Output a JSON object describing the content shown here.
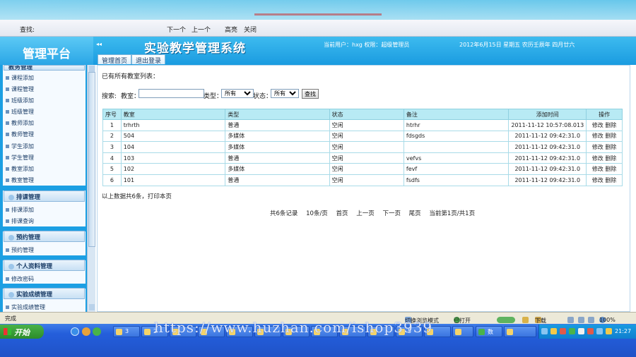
{
  "findbar": {
    "find_label": "查找:",
    "next": "下一个",
    "prev": "上一个",
    "highlight": "高亮",
    "close": "关闭"
  },
  "header": {
    "logo": "管理平台",
    "system_title": "实验教学管理系统",
    "user_info": "当前用户：hxg 权限：超级管理员",
    "date_info": "2012年6月15日 星期五 农历壬辰年 四月廿六",
    "collapse": "◂◂"
  },
  "tabs": [
    "管理首页",
    "退出登录"
  ],
  "sidebar": {
    "top_partial": "教务管理",
    "group1_items": [
      "课程添加",
      "课程管理",
      "班级添加",
      "班级管理",
      "教师添加",
      "教师管理",
      "学生添加",
      "学生管理",
      "教室添加",
      "教室管理"
    ],
    "groups": [
      {
        "title": "排课管理",
        "items": [
          "排课添加",
          "排课查询"
        ]
      },
      {
        "title": "预约管理",
        "items": [
          "预约管理"
        ]
      },
      {
        "title": "个人资料管理",
        "items": [
          "修改密码"
        ]
      },
      {
        "title": "实验成绩管理",
        "items": [
          "实验成绩管理"
        ]
      }
    ]
  },
  "main": {
    "title": "已有所有教室列表：",
    "search": {
      "label": "搜索:",
      "room_label": "教室：",
      "room_value": "",
      "type_label": "类型：",
      "type_selected": "所有",
      "status_label": "状态：",
      "status_selected": "所有",
      "button": "查找"
    },
    "table": {
      "headers": [
        "序号",
        "教室",
        "类型",
        "状态",
        "备注",
        "添加时间",
        "操作"
      ],
      "rows": [
        {
          "no": "1",
          "room": "trhrth",
          "type": "普通",
          "status": "空闲",
          "note": "htrhr",
          "time": "2011-11-12 10:57:08.013",
          "edit": "修改",
          "del": "删除"
        },
        {
          "no": "2",
          "room": "504",
          "type": "多媒体",
          "status": "空闲",
          "note": "fdsgds",
          "time": "2011-11-12 09:42:31.0",
          "edit": "修改",
          "del": "删除"
        },
        {
          "no": "3",
          "room": "104",
          "type": "多媒体",
          "status": "空闲",
          "note": "",
          "time": "2011-11-12 09:42:31.0",
          "edit": "修改",
          "del": "删除"
        },
        {
          "no": "4",
          "room": "103",
          "type": "普通",
          "status": "空闲",
          "note": "vefvs",
          "time": "2011-11-12 09:42:31.0",
          "edit": "修改",
          "del": "删除"
        },
        {
          "no": "5",
          "room": "102",
          "type": "多媒体",
          "status": "空闲",
          "note": "fevf",
          "time": "2011-11-12 09:42:31.0",
          "edit": "修改",
          "del": "删除"
        },
        {
          "no": "6",
          "room": "101",
          "type": "普通",
          "status": "空闲",
          "note": "fsdfs",
          "time": "2011-11-12 09:42:31.0",
          "edit": "修改",
          "del": "删除"
        }
      ]
    },
    "summary": "以上数据共6条，打印本页",
    "pager": {
      "total": "共6条记录",
      "per_page": "10条/页",
      "first": "首页",
      "prev": "上一页",
      "next": "下一页",
      "last": "尾页",
      "current": "当前第1页/共1页"
    }
  },
  "statusbar": {
    "done": "完成",
    "compat_mode": "切换浏览模式",
    "opened": "已打开",
    "download": "下载",
    "zoom": "100%"
  },
  "taskbar": {
    "start": "开始",
    "tasks": [
      "3",
      "2",
      "5",
      "数"
    ],
    "clock": "21:27"
  },
  "watermark": "https://www.huzhan.com/ishop3939",
  "colors": {
    "header": "#1a9be0",
    "table_header": "#b8eaf4",
    "taskbar": "#245edb"
  }
}
